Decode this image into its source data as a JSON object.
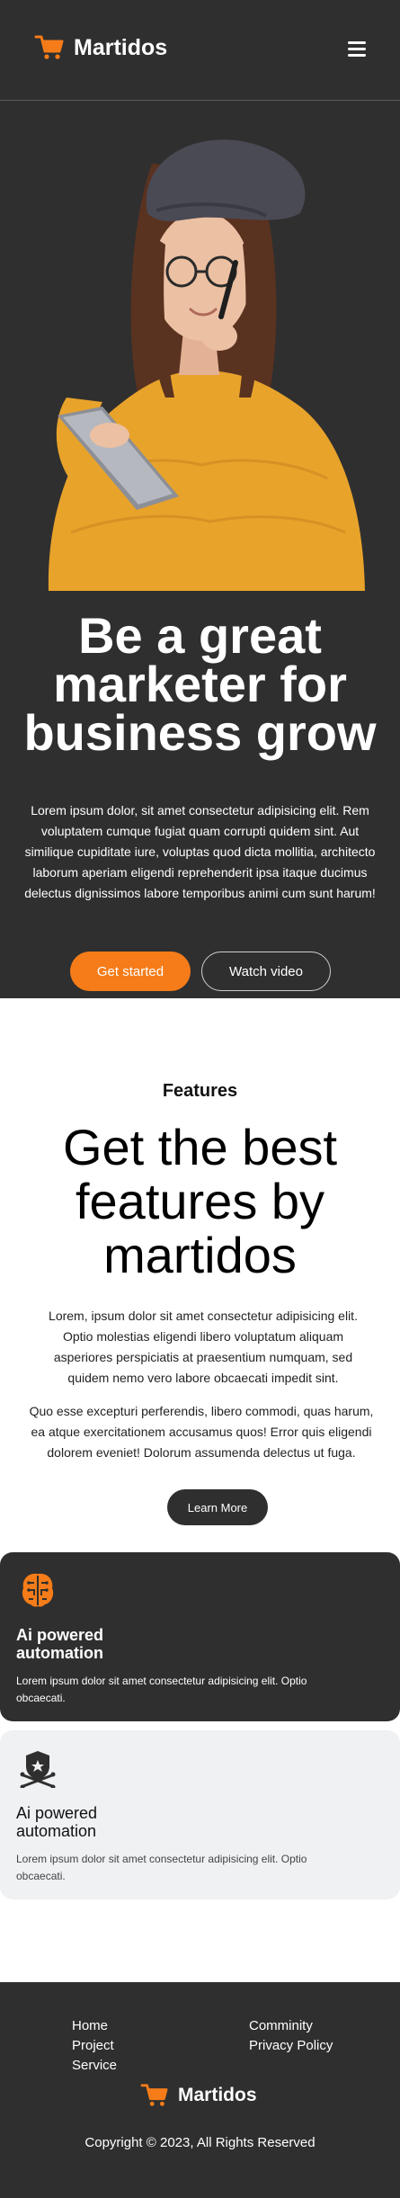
{
  "colors": {
    "accent": "#f57c19",
    "dark_bg": "#2f2f2f",
    "light_card": "#f0f1f3"
  },
  "header": {
    "brand": "Martidos",
    "logo_icon": "cart-icon",
    "menu_icon": "hamburger-menu-icon"
  },
  "hero": {
    "title": "Be a great marketer for business grow",
    "text": "Lorem ipsum dolor, sit amet consectetur adipisicing elit. Rem voluptatem cumque fugiat quam corrupti quidem sint. Aut similique cupiditate iure, voluptas quod dicta mollitia, architecto laborum aperiam eligendi reprehenderit ipsa itaque ducimus delectus dignissimos labore temporibus animi cum sunt harum!",
    "primary_button": "Get started",
    "secondary_button": "Watch video"
  },
  "features": {
    "label": "Features",
    "title": "Get the best features by martidos",
    "paragraph1": "Lorem, ipsum dolor sit amet consectetur adipisicing elit. Optio molestias eligendi libero voluptatum aliquam asperiores perspiciatis at praesentium numquam, sed quidem nemo vero labore obcaecati impedit sint.",
    "paragraph2": "Quo esse excepturi perferendis, libero commodi, quas harum, ea atque exercitationem accusamus quos! Error quis eligendi dolorem eveniet! Dolorum assumenda delectus ut fuga.",
    "button": "Learn More",
    "cards": [
      {
        "title": "Ai powered automation",
        "text": "Lorem ipsum dolor sit amet consectetur adipisicing elit. Optio obcaecati.",
        "icon": "brain-icon"
      },
      {
        "title": "Ai powered automation",
        "text": "Lorem ipsum dolor sit amet consectetur adipisicing elit. Optio obcaecati.",
        "icon": "shield-skull-icon"
      }
    ]
  },
  "footer": {
    "links_left": [
      "Home",
      "Project",
      "Service"
    ],
    "links_right": [
      "Comminity",
      "Privacy Policy"
    ],
    "brand": "Martidos",
    "copyright": "Copyright © 2023, All Rights Reserved"
  }
}
